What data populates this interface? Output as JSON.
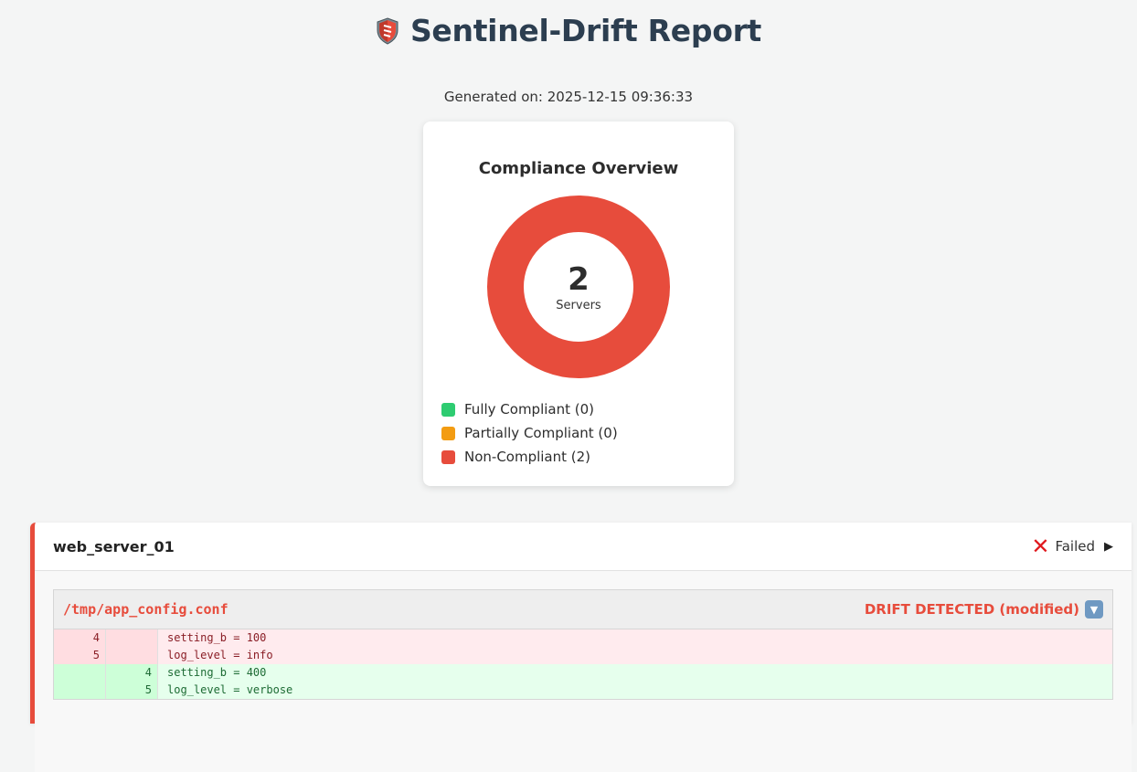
{
  "header": {
    "title": "Sentinel-Drift Report",
    "generated": "Generated on: 2025-12-15 09:36:33"
  },
  "chart_data": {
    "type": "pie",
    "title": "Compliance Overview",
    "center_value": "2",
    "center_label": "Servers",
    "categories": [
      "Fully Compliant (0)",
      "Partially Compliant (0)",
      "Non-Compliant (2)"
    ],
    "values": [
      0,
      0,
      2
    ],
    "colors": [
      "#2ecc71",
      "#f39c12",
      "#e74c3c"
    ]
  },
  "server": {
    "name": "web_server_01",
    "status": "Failed",
    "status_icon": "x-icon",
    "expand_icon": "play-icon",
    "file": {
      "path": "/tmp/app_config.conf",
      "drift_label": "DRIFT DETECTED (modified)",
      "toggle_icon": "chevron-down-icon",
      "diff": [
        {
          "type": "del",
          "old": "4",
          "new": "",
          "text": "setting_b = 100"
        },
        {
          "type": "del",
          "old": "5",
          "new": "",
          "text": "log_level = info"
        },
        {
          "type": "add",
          "old": "",
          "new": "4",
          "text": "setting_b = 400"
        },
        {
          "type": "add",
          "old": "",
          "new": "5",
          "text": "log_level = verbose"
        }
      ]
    }
  },
  "colors": {
    "accent_red": "#e74c3c",
    "heading": "#2c3e50"
  }
}
